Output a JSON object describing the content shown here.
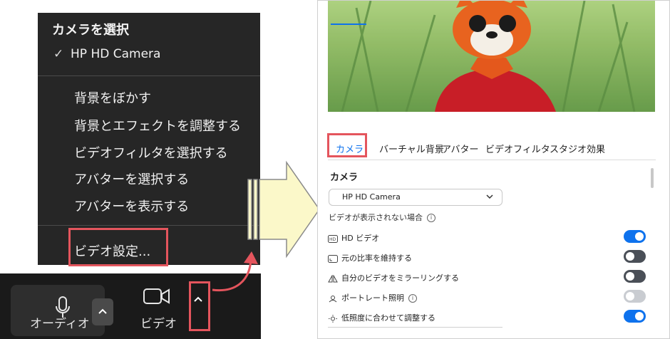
{
  "menu": {
    "title": "カメラを選択",
    "check_mark": "✓",
    "camera": "HP HD Camera",
    "items": [
      "背景をぼかす",
      "背景とエフェクトを調整する",
      "ビデオフィルタを選択する",
      "アバターを選択する",
      "アバターを表示する"
    ],
    "video_settings": "ビデオ設定..."
  },
  "toolbar": {
    "audio_label": "オーディオ",
    "video_label": "ビデオ",
    "caret": "^"
  },
  "settings": {
    "tabs": [
      "カメラ",
      "バーチャル背景",
      "アバター",
      "ビデオフィルタ",
      "スタジオ効果"
    ],
    "active_tab": "カメラ",
    "section_title": "カメラ",
    "camera_select": "HP HD Camera",
    "hint": "ビデオが表示されない場合",
    "info_icon": "i",
    "options": [
      {
        "icon": "hd-icon",
        "label": "HD ビデオ",
        "on": true
      },
      {
        "icon": "aspect-ratio-icon",
        "label": "元の比率を維持する",
        "on": false
      },
      {
        "icon": "mirror-icon",
        "label": "自分のビデオをミラーリングする",
        "on": false
      },
      {
        "icon": "portrait-light-icon",
        "label": "ポートレート照明",
        "on": false,
        "disabled": true,
        "info": true
      },
      {
        "icon": "brightness-icon",
        "label": "低照度に合わせて調整する",
        "on": true
      }
    ]
  },
  "colors": {
    "highlight": "#e4555d",
    "accent": "#0e72ed",
    "toggle_off": "#4a4f57",
    "toggle_disabled": "#c9ccd1",
    "arrow_fill": "#fbf8c9"
  }
}
